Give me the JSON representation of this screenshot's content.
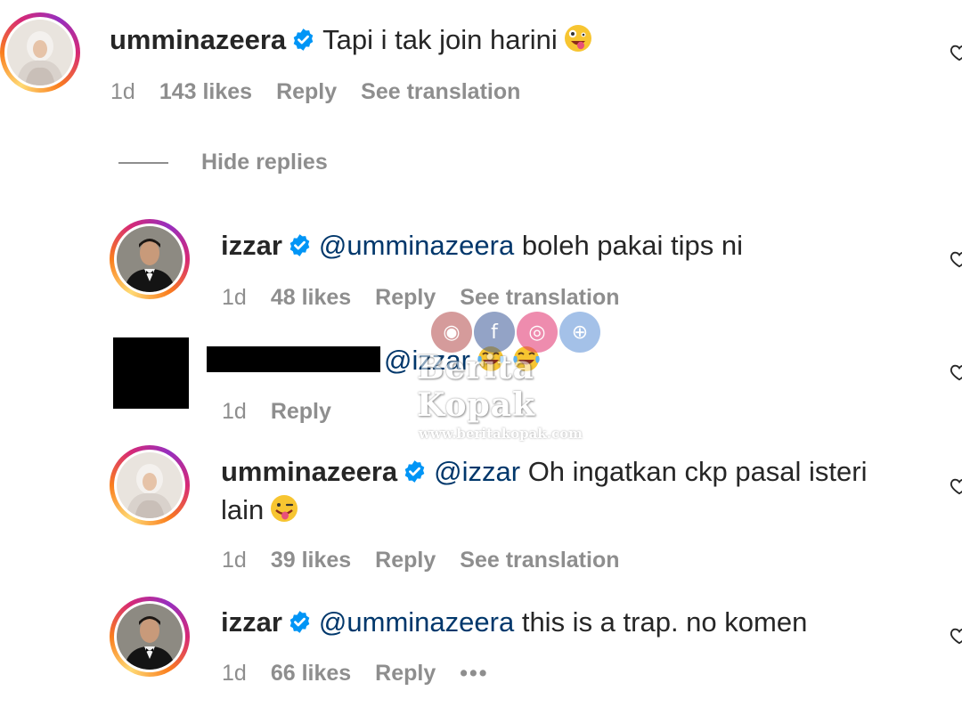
{
  "comments": [
    {
      "username": "umminazeera",
      "text": "Tapi i tak join harini",
      "time": "1d",
      "likes": "143 likes",
      "reply_label": "Reply",
      "translation_label": "See translation"
    },
    {
      "username": "izzar",
      "mention": "@umminazeera",
      "text": "boleh pakai tips ni",
      "time": "1d",
      "likes": "48 likes",
      "reply_label": "Reply",
      "translation_label": "See translation"
    },
    {
      "mention": "@izzar",
      "time": "1d",
      "reply_label": "Reply"
    },
    {
      "username": "umminazeera",
      "mention": "@izzar",
      "text_line1": "Oh ingatkan ckp pasal isteri",
      "text_line2": "lain",
      "time": "1d",
      "likes": "39 likes",
      "reply_label": "Reply",
      "translation_label": "See translation"
    },
    {
      "username": "izzar",
      "mention": "@umminazeera",
      "text": "this is a trap. no komen",
      "time": "1d",
      "likes": "66 likes",
      "reply_label": "Reply",
      "more_label": "•••"
    }
  ],
  "hide_replies_label": "Hide replies",
  "watermark": {
    "title": "Berita Kopak",
    "url": "www.beritakopak.com"
  },
  "colors": {
    "username": "#262626",
    "mention": "#00376b",
    "meta": "#8e8e8e",
    "verified": "#0095f6"
  }
}
